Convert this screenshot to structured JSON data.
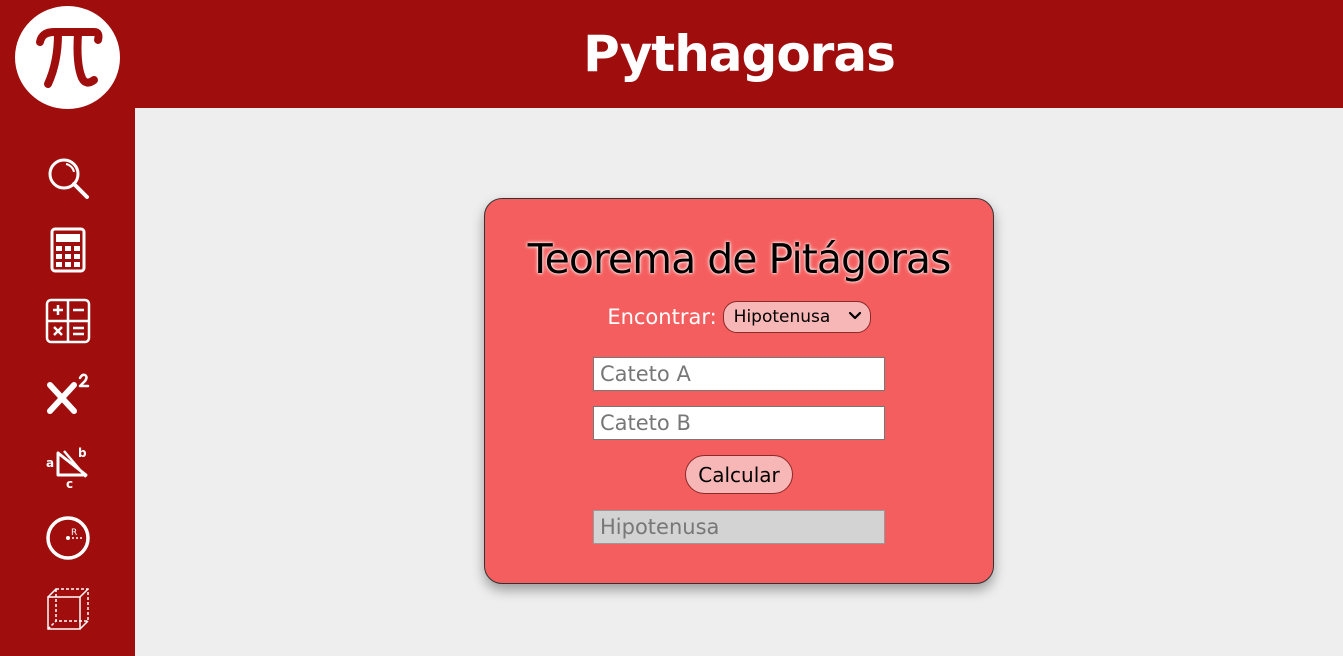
{
  "header": {
    "title": "Pythagoras"
  },
  "logo": {
    "icon": "pi-icon",
    "glyph": "π"
  },
  "sidebar": {
    "items": [
      {
        "name": "search",
        "icon": "search-icon"
      },
      {
        "name": "calculator",
        "icon": "calculator-icon"
      },
      {
        "name": "operations",
        "icon": "operations-icon"
      },
      {
        "name": "exponent",
        "icon": "exponent-icon"
      },
      {
        "name": "pythagoras",
        "icon": "triangle-icon"
      },
      {
        "name": "circle",
        "icon": "circle-radius-icon"
      },
      {
        "name": "cube",
        "icon": "cube-icon"
      }
    ]
  },
  "card": {
    "title": "Teorema de Pitágoras",
    "find_label": "Encontrar:",
    "find_selected": "Hipotenusa",
    "input_a_placeholder": "Cateto A",
    "input_b_placeholder": "Cateto B",
    "calculate_label": "Calcular",
    "result_placeholder": "Hipotenusa"
  },
  "colors": {
    "primary": "#a00d0d",
    "card": "#f55e5e",
    "button": "#f8b7b7",
    "background": "#eeeeee"
  }
}
